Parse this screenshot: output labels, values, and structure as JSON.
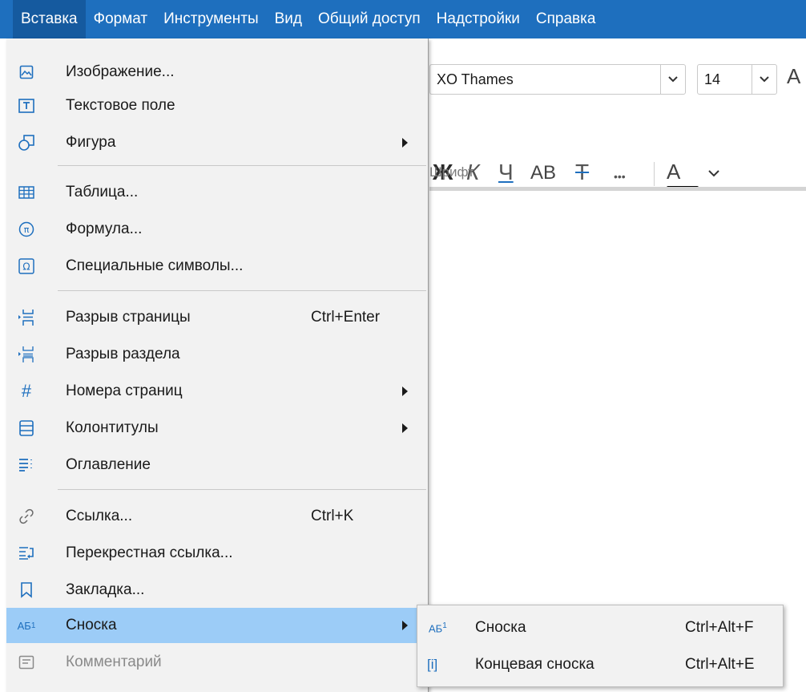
{
  "menubar": {
    "items": [
      {
        "label": "Вставка"
      },
      {
        "label": "Формат"
      },
      {
        "label": "Инструменты"
      },
      {
        "label": "Вид"
      },
      {
        "label": "Общий доступ"
      },
      {
        "label": "Надстройки"
      },
      {
        "label": "Справка"
      }
    ],
    "active_index": 0,
    "color": "#1e6fbe"
  },
  "toolbar": {
    "font_name": "XO Thames",
    "font_size": "14",
    "bold": "Ж",
    "italic": "К",
    "underline": "Ч",
    "case": "АВ",
    "strike": "Т",
    "more": "•••",
    "font_color": "А",
    "section_label": "Шрифт"
  },
  "insert_menu": {
    "items": [
      {
        "label": "Изображение...",
        "icon": "image-icon"
      },
      {
        "label": "Текстовое поле",
        "icon": "text-box-icon"
      },
      {
        "label": "Фигура",
        "icon": "shape-icon",
        "submenu": true
      },
      {
        "label": "Таблица...",
        "icon": "table-icon"
      },
      {
        "label": "Формула...",
        "icon": "pi-icon"
      },
      {
        "label": "Специальные символы...",
        "icon": "omega-icon"
      },
      {
        "label": "Разрыв страницы",
        "shortcut": "Ctrl+Enter",
        "icon": "page-break-icon"
      },
      {
        "label": "Разрыв раздела",
        "icon": "section-break-icon"
      },
      {
        "label": "Номера страниц",
        "icon": "hash-icon",
        "submenu": true
      },
      {
        "label": "Колонтитулы",
        "icon": "header-footer-icon",
        "submenu": true
      },
      {
        "label": "Оглавление",
        "icon": "toc-icon"
      },
      {
        "label": "Ссылка...",
        "shortcut": "Ctrl+K",
        "icon": "link-icon"
      },
      {
        "label": "Перекрестная ссылка...",
        "icon": "cross-reference-icon"
      },
      {
        "label": "Закладка...",
        "icon": "bookmark-icon"
      },
      {
        "label": "Сноска",
        "icon": "footnote-icon",
        "submenu": true,
        "highlighted": true
      },
      {
        "label": "Комментарий",
        "icon": "comment-icon",
        "disabled": true
      }
    ],
    "highlight_color": "#9cccf7"
  },
  "footnote_submenu": {
    "items": [
      {
        "label": "Сноска",
        "shortcut": "Ctrl+Alt+F",
        "icon": "footnote-icon",
        "icon_text": "АБ"
      },
      {
        "label": "Концевая сноска",
        "shortcut": "Ctrl+Alt+E",
        "icon": "endnote-icon",
        "icon_text": "[i]"
      }
    ]
  }
}
